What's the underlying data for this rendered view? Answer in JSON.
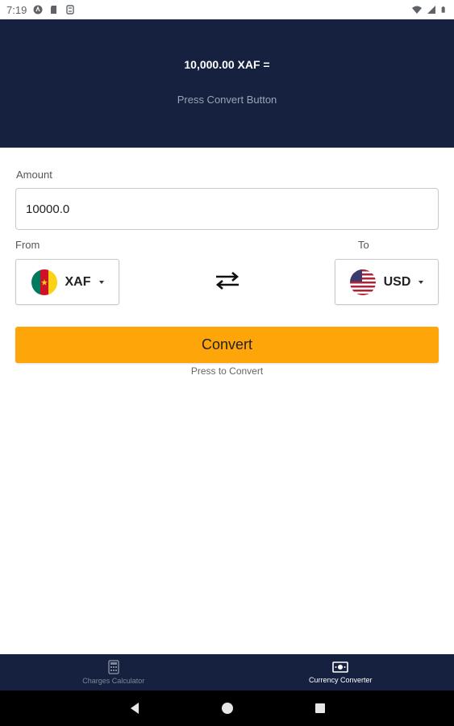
{
  "status_bar": {
    "time": "7:19"
  },
  "header": {
    "result_text": "10,000.00 XAF =",
    "hint_text": "Press Convert Button"
  },
  "form": {
    "amount_label": "Amount",
    "amount_value": "10000.0",
    "from_label": "From",
    "to_label": "To",
    "from_currency": "XAF",
    "to_currency": "USD"
  },
  "convert": {
    "button_label": "Convert",
    "hint": "Press to Convert",
    "color": "#fea50a"
  },
  "bottom_nav": {
    "items": [
      {
        "label": "Charges Calculator",
        "icon": "calculator-icon",
        "active": false
      },
      {
        "label": "Currency Converter",
        "icon": "money-icon",
        "active": true
      }
    ]
  },
  "colors": {
    "header_bg": "#15213f",
    "accent": "#fea50a"
  }
}
